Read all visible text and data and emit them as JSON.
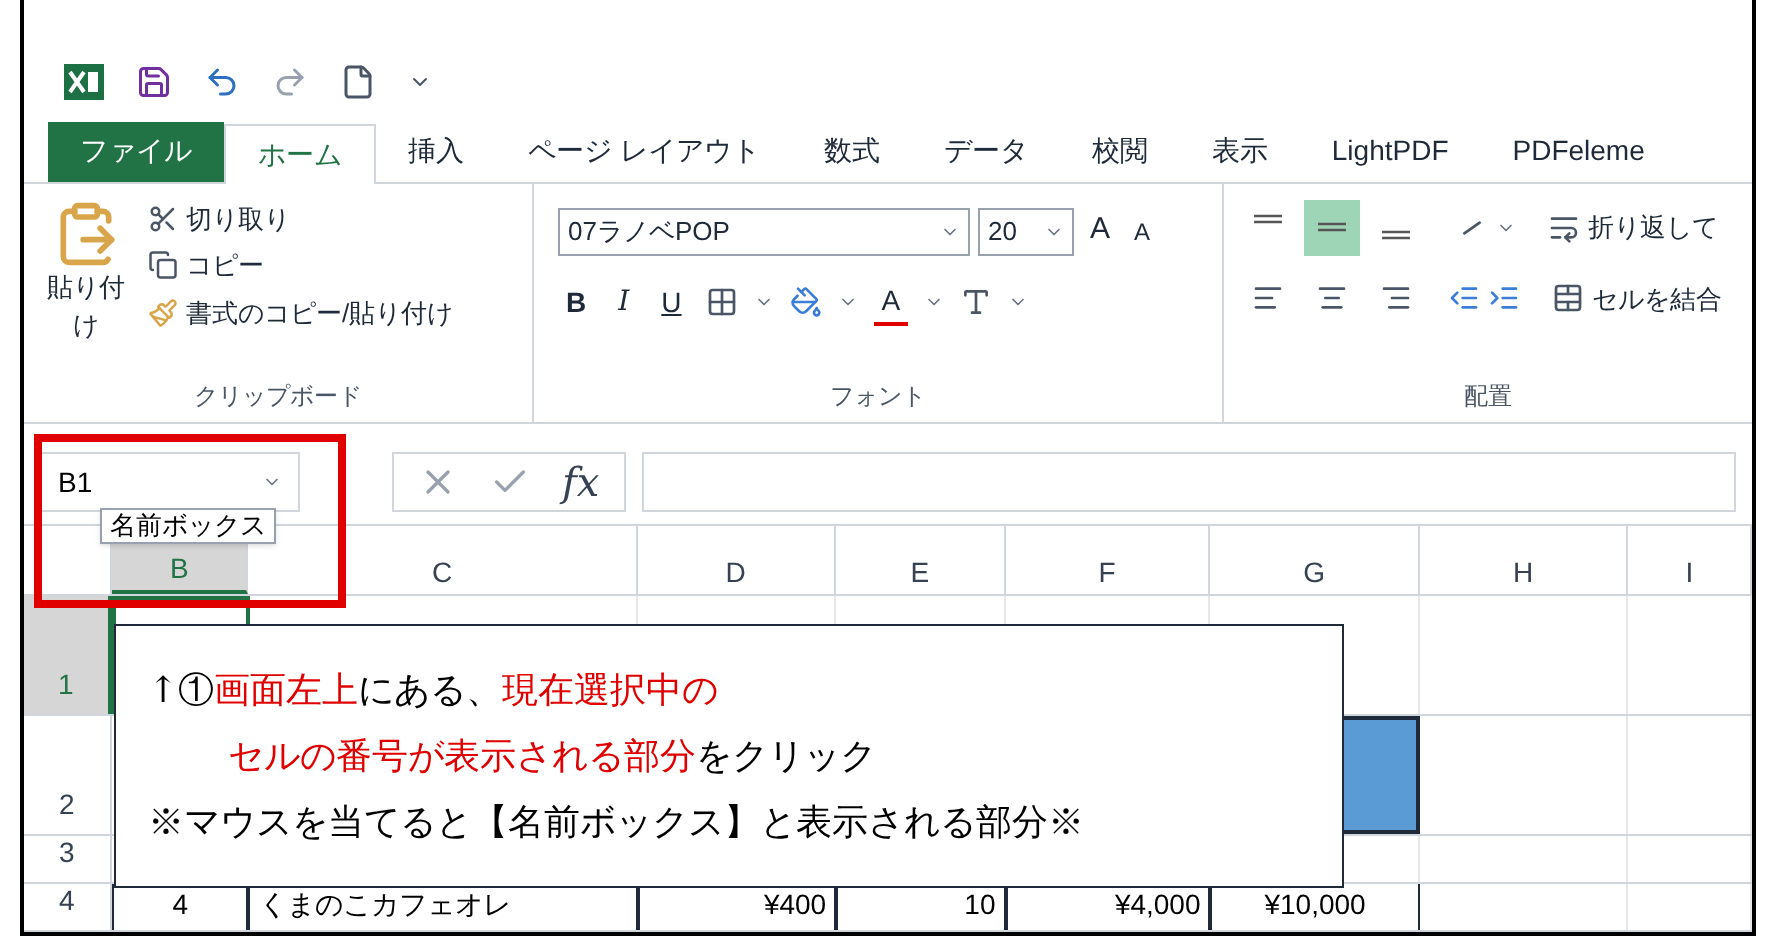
{
  "tabs": [
    {
      "label": "ファイル",
      "kind": "file",
      "selected": false
    },
    {
      "label": "ホーム",
      "kind": "tab",
      "selected": true
    },
    {
      "label": "挿入",
      "kind": "tab",
      "selected": false
    },
    {
      "label": "ページ レイアウト",
      "kind": "tab",
      "selected": false
    },
    {
      "label": "数式",
      "kind": "tab",
      "selected": false
    },
    {
      "label": "データ",
      "kind": "tab",
      "selected": false
    },
    {
      "label": "校閲",
      "kind": "tab",
      "selected": false
    },
    {
      "label": "表示",
      "kind": "tab",
      "selected": false
    },
    {
      "label": "LightPDF",
      "kind": "tab",
      "selected": false
    },
    {
      "label": "PDFeleme",
      "kind": "tab",
      "selected": false
    }
  ],
  "ribbon": {
    "clipboard": {
      "paste": "貼り付け",
      "items": [
        "切り取り",
        "コピー",
        "書式のコピー/貼り付け"
      ],
      "label": "クリップボード"
    },
    "font": {
      "font_name": "07ラノベPOP",
      "font_size": "20",
      "grow": "A",
      "shrink": "A",
      "styles": [
        "B",
        "I",
        "U"
      ],
      "font_color": "A",
      "label": "フォント"
    },
    "alignment": {
      "vertical_align": [
        {
          "selected": false
        },
        {
          "selected": true
        },
        {
          "selected": false
        }
      ],
      "wrap_text": "折り返して",
      "merge": "セルを結合",
      "label": "配置"
    }
  },
  "formula_bar": {
    "name_box": "B1",
    "fx": "fx",
    "tooltip": "名前ボックス"
  },
  "columns": [
    {
      "label": "B",
      "selected": true
    },
    {
      "label": "C",
      "selected": false
    },
    {
      "label": "D",
      "selected": false
    },
    {
      "label": "E",
      "selected": false
    },
    {
      "label": "F",
      "selected": false
    },
    {
      "label": "G",
      "selected": false
    },
    {
      "label": "H",
      "selected": false
    },
    {
      "label": "I",
      "selected": false
    }
  ],
  "rows": [
    {
      "label": "1",
      "selected": true
    },
    {
      "label": "2",
      "selected": false,
      "cells": [
        {
          "kind": "empty"
        },
        {
          "kind": "empty"
        },
        {
          "kind": "empty"
        },
        {
          "kind": "empty"
        },
        {
          "kind": "empty"
        },
        {
          "kind": "filled"
        }
      ]
    },
    {
      "label": "3",
      "selected": false
    },
    {
      "label": "4",
      "selected": false,
      "cells": [
        {
          "kind": "text",
          "text": "4"
        },
        {
          "kind": "text",
          "text": "くまのこカフェオレ"
        },
        {
          "kind": "text",
          "text": "¥400"
        },
        {
          "kind": "text",
          "text": "10"
        },
        {
          "kind": "text",
          "text": "¥4,000"
        },
        {
          "kind": "text",
          "text": "¥10,000"
        }
      ]
    }
  ],
  "callout": {
    "lines": [
      [
        {
          "text": "↑①",
          "emphasis": false
        },
        {
          "text": "画面左上",
          "emphasis": true
        },
        {
          "text": "にある、",
          "emphasis": false
        },
        {
          "text": "現在選択中の",
          "emphasis": true
        }
      ],
      [
        {
          "text": "セルの番号が表示される部分",
          "emphasis": true
        },
        {
          "text": "をクリック",
          "emphasis": false
        }
      ],
      [
        {
          "text": "※マウスを当てると【名前ボックス】と表示される部分※",
          "emphasis": false
        }
      ]
    ]
  }
}
